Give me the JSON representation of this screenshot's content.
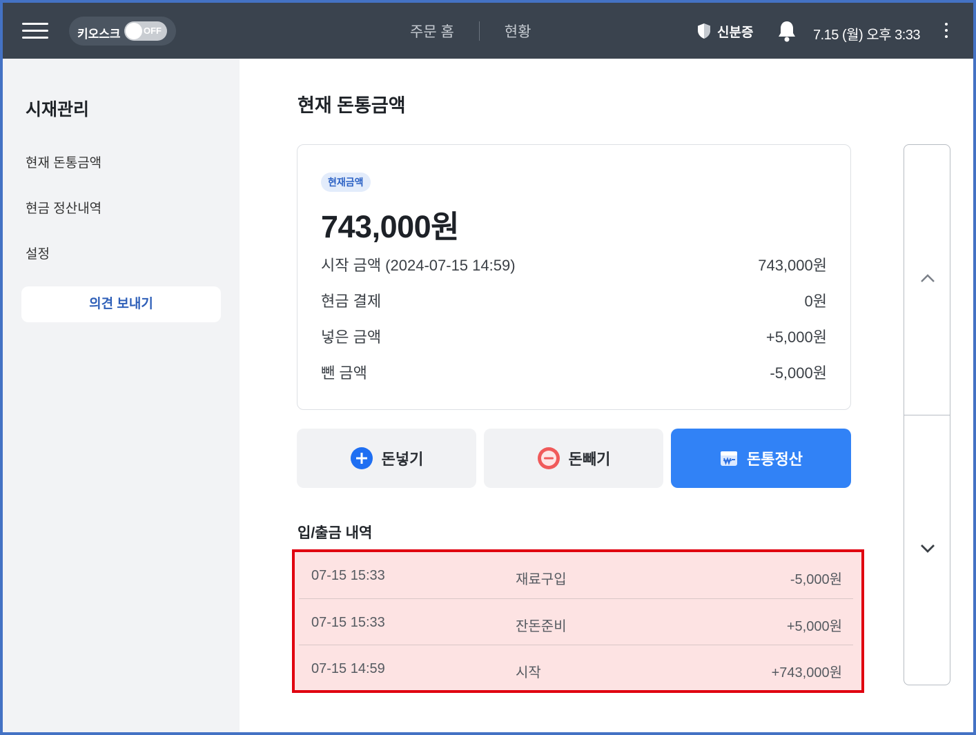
{
  "header": {
    "kiosk_label": "키오스크",
    "kiosk_toggle_state": "OFF",
    "nav": [
      "주문 홈",
      "현황"
    ],
    "certificate_label": "신분증",
    "datetime": "7.15 (월) 오후 3:33"
  },
  "sidebar": {
    "title": "시재관리",
    "items": [
      {
        "label": "현재 돈통금액"
      },
      {
        "label": "현금 정산내역"
      },
      {
        "label": "설정"
      }
    ],
    "feedback_label": "의견 보내기"
  },
  "main": {
    "title": "현재 돈통금액",
    "card": {
      "badge": "현재금액",
      "current_amount": "743,000원",
      "rows": [
        {
          "label": "시작 금액 (2024-07-15 14:59)",
          "value": "743,000원"
        },
        {
          "label": "현금 결제",
          "value": "0원"
        },
        {
          "label": "넣은 금액",
          "value": "+5,000원"
        },
        {
          "label": "뺀 금액",
          "value": "-5,000원"
        }
      ]
    },
    "actions": {
      "deposit": "돈넣기",
      "withdraw": "돈빼기",
      "settle": "돈통정산"
    },
    "history_title": "입/출금 내역",
    "history": [
      {
        "date": "07-15 15:33",
        "desc": "재료구입",
        "amount": "-5,000원"
      },
      {
        "date": "07-15 15:33",
        "desc": "잔돈준비",
        "amount": "+5,000원"
      },
      {
        "date": "07-15 14:59",
        "desc": "시작",
        "amount": "+743,000원"
      }
    ]
  },
  "colors": {
    "topbar": "#3a434e",
    "accent_blue": "#3182f6",
    "highlight_border": "#e0000f",
    "highlight_fill": "#fde3e3",
    "withdraw_red": "#f05a5a"
  },
  "icons": [
    "hamburger-icon",
    "shield-icon",
    "bell-icon",
    "more-vertical-icon",
    "plus-circle-icon",
    "minus-circle-icon",
    "cash-register-icon",
    "chevron-up-icon",
    "chevron-down-icon"
  ]
}
